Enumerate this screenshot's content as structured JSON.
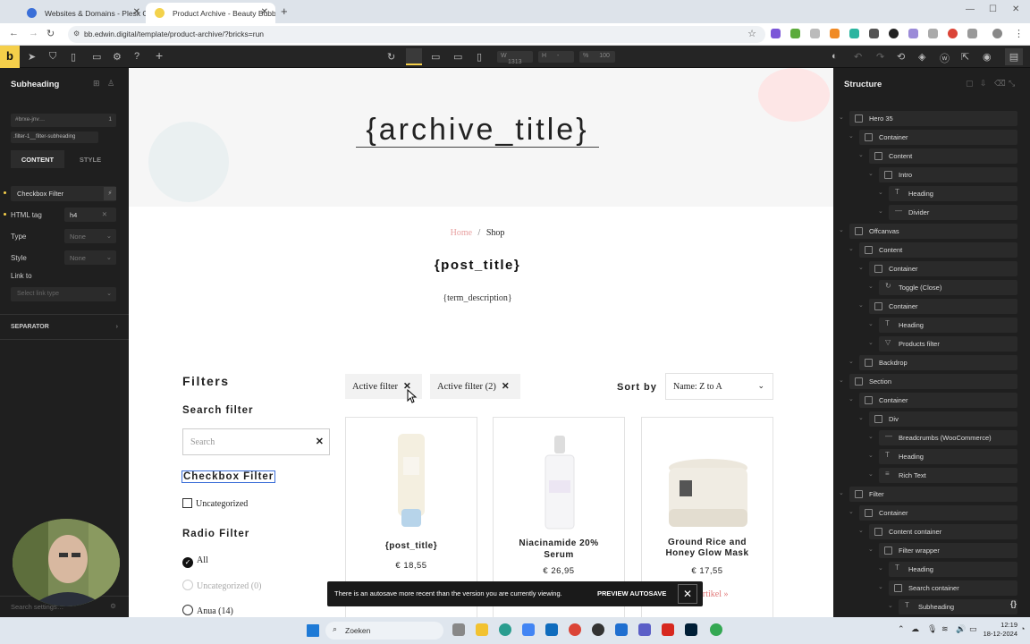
{
  "browser": {
    "tabs": [
      {
        "label": "Websites & Domains - Plesk Ob"
      },
      {
        "label": "Product Archive - Beauty Bubble"
      }
    ],
    "new_tab": "+",
    "url": "bb.edwin.digital/template/product-archive/?bricks=run",
    "tab_close": "✕"
  },
  "builder": {
    "logo": "b",
    "width_label": "W",
    "width_value": "1313",
    "height_label": "H",
    "height_value": "-",
    "scale_label": "%",
    "scale_value": "100"
  },
  "left_panel": {
    "title": "Subheading",
    "selector_id": "#brxe-jnv…",
    "selector_count": "1",
    "selector_class": ".filter-1__filter-subheading",
    "tab_content": "CONTENT",
    "tab_style": "STYLE",
    "text_value": "Checkbox Filter",
    "html_tag_label": "HTML tag",
    "html_tag_value": "h4",
    "type_label": "Type",
    "type_value": "None",
    "style_label": "Style",
    "style_value": "None",
    "link_label": "Link to",
    "link_placeholder": "Select link type",
    "separator_label": "SEPARATOR",
    "search_placeholder": "Search settings…"
  },
  "page": {
    "archive_title": "{archive_title}",
    "breadcrumb_home": "Home",
    "breadcrumb_sep": "/",
    "breadcrumb_current": "Shop",
    "post_title": "{post_title}",
    "term_description": "{term_description}",
    "filters_heading": "Filters",
    "search_filter_heading": "Search filter",
    "search_placeholder": "Search",
    "checkbox_filter_heading": "Checkbox Filter",
    "checkbox_options": [
      "Uncategorized"
    ],
    "radio_filter_heading": "Radio Filter",
    "radio_options": [
      {
        "label": "All",
        "checked": true
      },
      {
        "label": "Uncategorized (0)",
        "checked": false
      },
      {
        "label": "Anua (14)",
        "checked": false
      }
    ],
    "active_filters": [
      "Active filter",
      "Active filter (2)"
    ],
    "sort_label": "Sort by",
    "sort_value": "Name: Z to A",
    "products": [
      {
        "title": "{post_title}",
        "price": "€ 18,55"
      },
      {
        "title": "Niacinamide 20% Serum",
        "price": "€ 26,95"
      },
      {
        "title": "Ground Rice and Honey Glow Mask",
        "price": "€ 17,55"
      }
    ],
    "product_link": "artikel »"
  },
  "toast": {
    "message": "There is an autosave more recent than the version you are currently viewing.",
    "button": "PREVIEW AUTOSAVE"
  },
  "structure": {
    "title": "Structure",
    "items": [
      {
        "label": "Hero 35",
        "depth": 0,
        "icon": "box"
      },
      {
        "label": "Container",
        "depth": 1,
        "icon": "box"
      },
      {
        "label": "Content",
        "depth": 2,
        "icon": "box"
      },
      {
        "label": "Intro",
        "depth": 3,
        "icon": "box"
      },
      {
        "label": "Heading",
        "depth": 4,
        "icon": "T"
      },
      {
        "label": "Divider",
        "depth": 4,
        "icon": "—"
      },
      {
        "label": "Offcanvas",
        "depth": 0,
        "icon": "box"
      },
      {
        "label": "Content",
        "depth": 1,
        "icon": "box"
      },
      {
        "label": "Container",
        "depth": 2,
        "icon": "box"
      },
      {
        "label": "Toggle (Close)",
        "depth": 3,
        "icon": "↻"
      },
      {
        "label": "Container",
        "depth": 2,
        "icon": "box"
      },
      {
        "label": "Heading",
        "depth": 3,
        "icon": "T"
      },
      {
        "label": "Products filter",
        "depth": 3,
        "icon": "▽"
      },
      {
        "label": "Backdrop",
        "depth": 1,
        "icon": "box"
      },
      {
        "label": "Section",
        "depth": 0,
        "icon": "box"
      },
      {
        "label": "Container",
        "depth": 1,
        "icon": "box"
      },
      {
        "label": "Div",
        "depth": 2,
        "icon": "box"
      },
      {
        "label": "Breadcrumbs (WooCommerce)",
        "depth": 3,
        "icon": "—"
      },
      {
        "label": "Heading",
        "depth": 3,
        "icon": "T"
      },
      {
        "label": "Rich Text",
        "depth": 3,
        "icon": "≡"
      },
      {
        "label": "Filter",
        "depth": 0,
        "icon": "box"
      },
      {
        "label": "Container",
        "depth": 1,
        "icon": "box"
      },
      {
        "label": "Content container",
        "depth": 2,
        "icon": "box"
      },
      {
        "label": "Filter wrapper",
        "depth": 3,
        "icon": "box"
      },
      {
        "label": "Heading",
        "depth": 4,
        "icon": "T"
      },
      {
        "label": "Search container",
        "depth": 4,
        "icon": "box"
      },
      {
        "label": "Subheading",
        "depth": 5,
        "icon": "T"
      }
    ]
  },
  "taskbar": {
    "search_placeholder": "Zoeken",
    "time": "12:19",
    "date": "18-12-2024"
  }
}
